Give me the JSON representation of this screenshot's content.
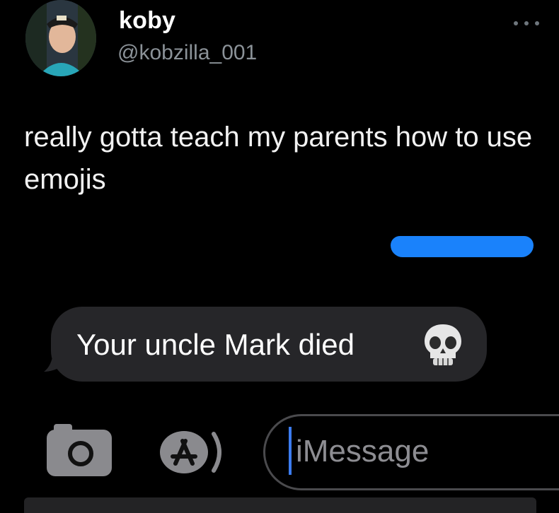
{
  "tweet": {
    "author": {
      "display_name": "koby",
      "handle": "@kobzilla_001"
    },
    "more_icon": "more-horizontal-icon",
    "text": "really gotta teach my parents how to use emojis"
  },
  "imessage": {
    "sent_bubble_color": "#1a82fb",
    "received_message": "Your uncle Mark died",
    "received_emoji": "skull-icon",
    "input_placeholder": "iMessage",
    "toolbar_icons": [
      "camera-icon",
      "app-store-icon"
    ]
  }
}
